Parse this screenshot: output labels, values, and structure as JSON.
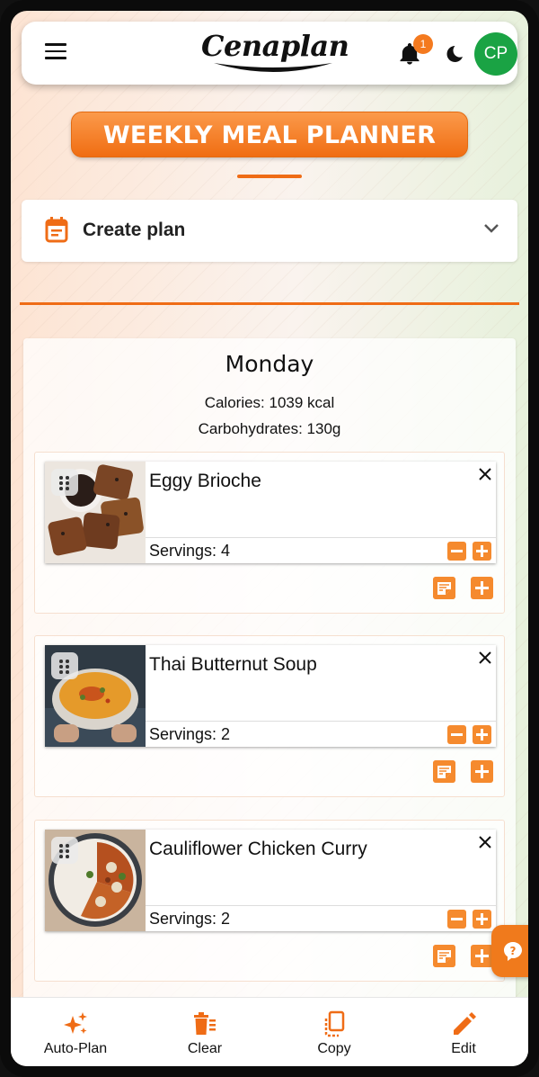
{
  "header": {
    "menu_icon": "hamburger-menu-icon",
    "logo_text": "Cenaplan",
    "notification_count": "1",
    "theme_icon": "moon-icon",
    "avatar_initials": "CP",
    "avatar_color": "#1aa344"
  },
  "page_title": "WEEKLY MEAL PLANNER",
  "create_plan": {
    "icon": "calendar-icon",
    "label": "Create plan",
    "toggle_icon": "chevron-down-icon"
  },
  "accent_color": "#ef6c16",
  "day": {
    "name": "Monday",
    "calories": "Calories: 1039 kcal",
    "carbohydrates": "Carbohydrates: 130g",
    "meals": [
      {
        "title": "Eggy Brioche",
        "servings": "Servings: 4",
        "image": "eggy-brioche-photo"
      },
      {
        "title": "Thai Butternut Soup",
        "servings": "Servings: 2",
        "image": "thai-butternut-soup-photo"
      },
      {
        "title": "Cauliflower Chicken Curry",
        "servings": "Servings: 2",
        "image": "cauliflower-chicken-curry-photo"
      }
    ]
  },
  "help_button_icon": "help-icon",
  "bottom_nav": {
    "items": [
      {
        "label": "Auto-Plan",
        "icon": "sparkles-icon"
      },
      {
        "label": "Clear",
        "icon": "trash-icon"
      },
      {
        "label": "Copy",
        "icon": "copy-icon"
      },
      {
        "label": "Edit",
        "icon": "pencil-icon"
      }
    ]
  }
}
